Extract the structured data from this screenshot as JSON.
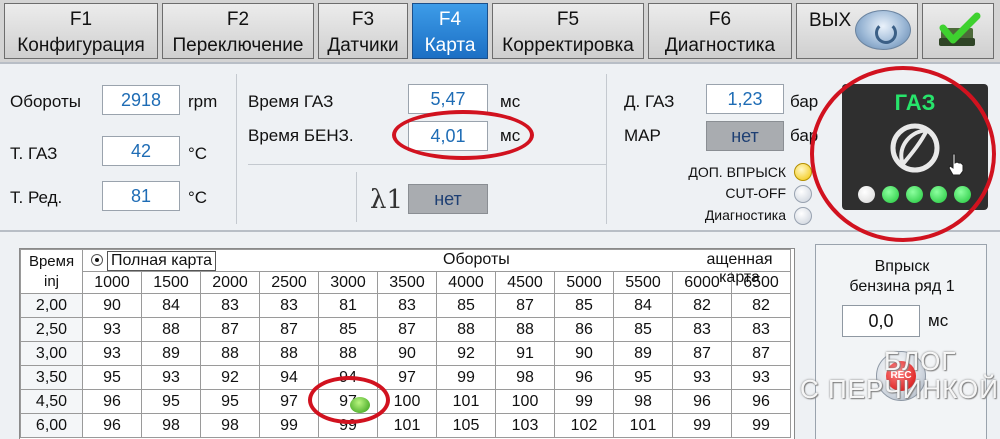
{
  "tabs": [
    {
      "key": "F1",
      "label": "Конфигурация"
    },
    {
      "key": "F2",
      "label": "Переключение"
    },
    {
      "key": "F3",
      "label": "Датчики"
    },
    {
      "key": "F4",
      "label": "Карта"
    },
    {
      "key": "F5",
      "label": "Корректировка"
    },
    {
      "key": "F6",
      "label": "Диагностика"
    }
  ],
  "active_tab": "F4",
  "exit_label": "ВЫХ",
  "sensors": {
    "rpm_label": "Обороты",
    "rpm_value": "2918",
    "rpm_unit": "rpm",
    "tgas_label": "Т. ГАЗ",
    "tgas_value": "42",
    "tgas_unit": "°C",
    "tred_label": "Т. Ред.",
    "tred_value": "81",
    "tred_unit": "°C"
  },
  "times": {
    "gas_label": "Время ГАЗ",
    "gas_value": "5,47",
    "gas_unit": "мс",
    "benz_label": "Время БЕНЗ.",
    "benz_value": "4,01",
    "benz_unit": "мс",
    "lambda_label": "λ1",
    "lambda_value": "нет"
  },
  "pressure": {
    "dgas_label": "Д. ГАЗ",
    "dgas_value": "1,23",
    "dgas_unit": "бар",
    "map_label": "MAP",
    "map_value": "нет",
    "map_unit": "бар"
  },
  "flags": [
    {
      "label": "ДОП. ВПРЫСК",
      "on": true
    },
    {
      "label": "CUT-OFF",
      "on": false
    },
    {
      "label": "Диагностика",
      "on": false
    }
  ],
  "fuel_indicator": {
    "title": "ГАЗ",
    "leds": [
      "white",
      "green",
      "green",
      "green",
      "green"
    ]
  },
  "map_table": {
    "corner_label_1": "Время",
    "corner_label_2": "inj",
    "full_map_label": "Полная карта",
    "rpm_header": "Обороты",
    "reduced_map_label": "ащенная карта",
    "rpm_columns": [
      "1000",
      "1500",
      "2000",
      "2500",
      "3000",
      "3500",
      "4000",
      "4500",
      "5000",
      "5500",
      "6000",
      "6500"
    ],
    "rows": [
      {
        "inj": "2,00",
        "cells": [
          "90",
          "84",
          "83",
          "83",
          "81",
          "83",
          "85",
          "87",
          "85",
          "84",
          "82",
          "82"
        ]
      },
      {
        "inj": "2,50",
        "cells": [
          "93",
          "88",
          "87",
          "87",
          "85",
          "87",
          "88",
          "88",
          "86",
          "85",
          "83",
          "83"
        ]
      },
      {
        "inj": "3,00",
        "cells": [
          "93",
          "89",
          "88",
          "88",
          "88",
          "90",
          "92",
          "91",
          "90",
          "89",
          "87",
          "87"
        ]
      },
      {
        "inj": "3,50",
        "cells": [
          "95",
          "93",
          "92",
          "94",
          "94",
          "97",
          "99",
          "98",
          "96",
          "95",
          "93",
          "93"
        ]
      },
      {
        "inj": "4,50",
        "cells": [
          "96",
          "95",
          "95",
          "97",
          "97",
          "100",
          "101",
          "100",
          "99",
          "98",
          "96",
          "96"
        ]
      },
      {
        "inj": "6,00",
        "cells": [
          "96",
          "98",
          "98",
          "99",
          "99",
          "101",
          "105",
          "103",
          "102",
          "101",
          "99",
          "99"
        ]
      }
    ]
  },
  "injection_panel": {
    "title_line1": "Впрыск",
    "title_line2": "бензина ряд 1",
    "value": "0,0",
    "unit": "мс",
    "rec_label": "REC"
  },
  "watermark": {
    "line1": "БЛОГ",
    "line2": "С ПЕРЧИНКОЙ"
  },
  "colors": {
    "active_tab": "#1c6fc4",
    "value_text": "#1e6cb5",
    "annotation": "#d1121f",
    "gas_title": "#27e46b",
    "led_on": "#1fc53a"
  }
}
